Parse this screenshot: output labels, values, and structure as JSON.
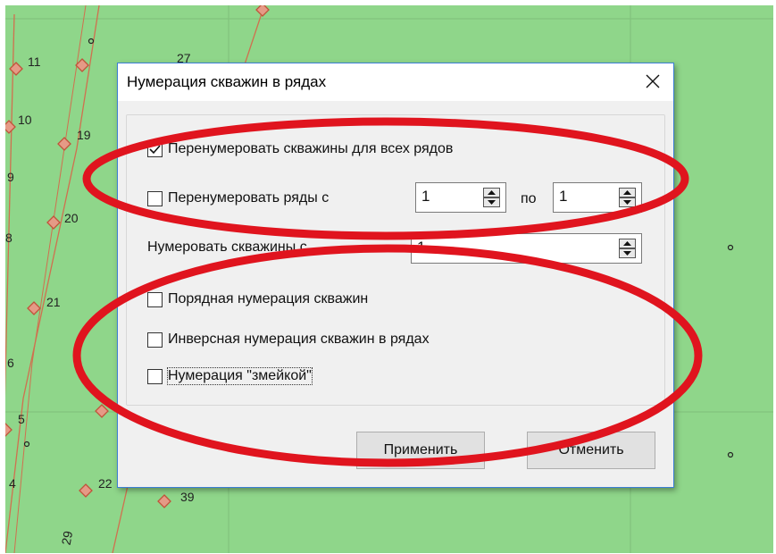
{
  "map": {
    "labels": [
      "11",
      "10",
      "19",
      "9",
      "20",
      "8",
      "21",
      "6",
      "5",
      "4",
      "22",
      "39",
      "27",
      "29"
    ],
    "colors": {
      "background": "#8fd68a",
      "line": "#d0704f",
      "marker": "#c0533a"
    }
  },
  "dialog": {
    "title": "Нумерация скважин в рядах",
    "options": {
      "renumber_all": {
        "label": "Перенумеровать скважины  для всех рядов",
        "checked": true
      },
      "renumber_rows": {
        "label": "Перенумеровать ряды с",
        "checked": false
      },
      "sequential": {
        "label": "Порядная нумерация скважин",
        "checked": false
      },
      "inverse": {
        "label": "Инверсная нумерация скважин в рядах",
        "checked": false
      },
      "snake": {
        "label": "Нумерация \"змейкой\"",
        "checked": false
      }
    },
    "rows_from": "1",
    "rows_to_label": "по",
    "rows_to": "1",
    "start_label": "Нумеровать скважины с",
    "start_value": "1",
    "apply_button": "Применить",
    "cancel_button": "Отменить"
  },
  "annotation_color": "#e0141e"
}
